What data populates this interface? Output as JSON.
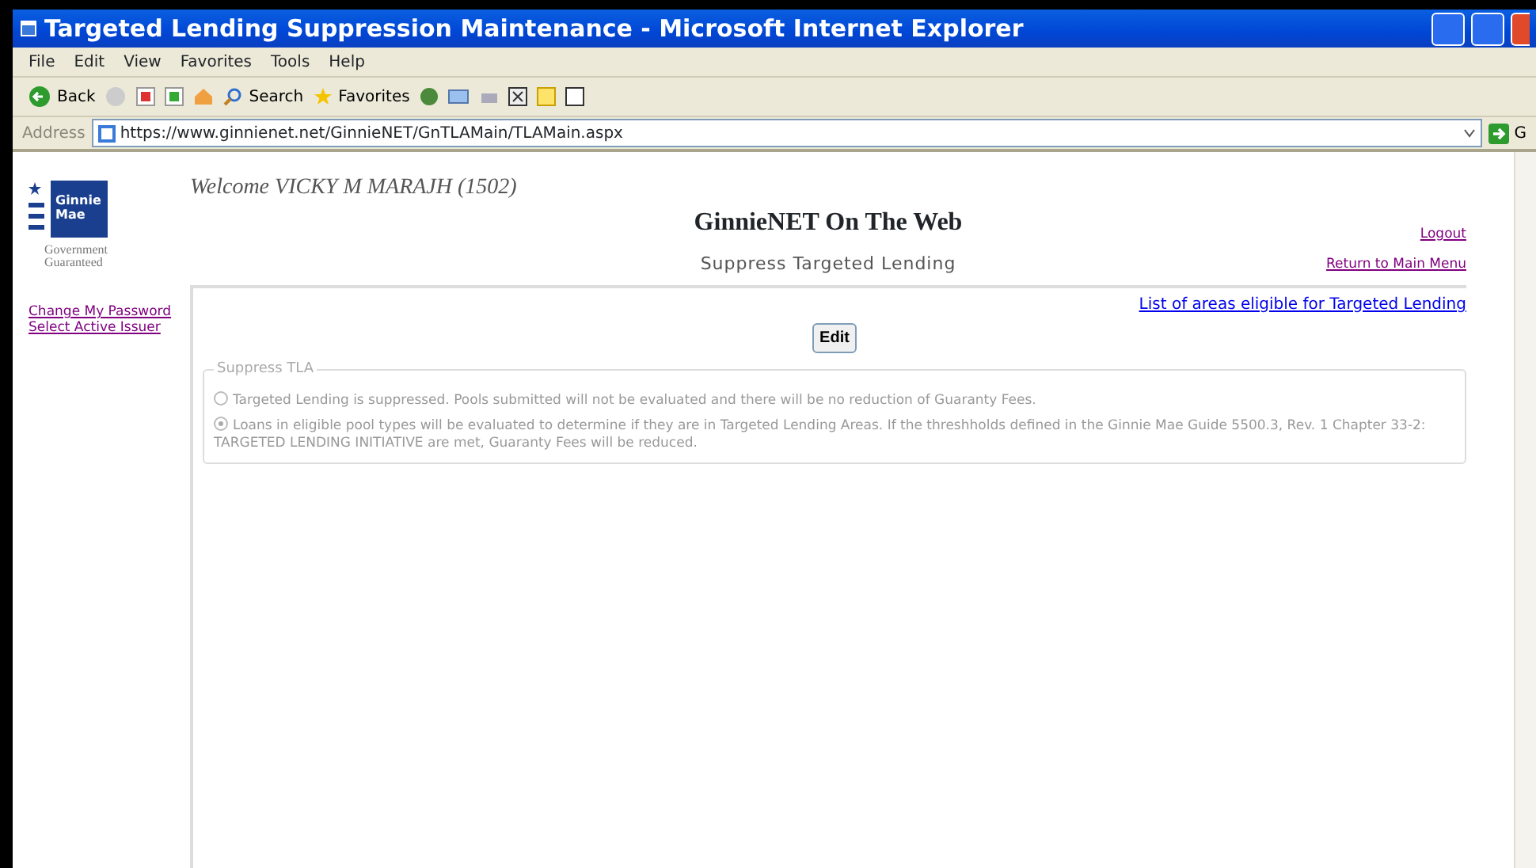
{
  "window": {
    "title": "Targeted Lending Suppression Maintenance - Microsoft Internet Explorer"
  },
  "menu": [
    "File",
    "Edit",
    "View",
    "Favorites",
    "Tools",
    "Help"
  ],
  "toolbar": {
    "back": "Back",
    "search": "Search",
    "favorites": "Favorites"
  },
  "address_bar": {
    "label": "Address",
    "url": "https://www.ginnienet.net/GinnieNET/GnTLAMain/TLAMain.aspx",
    "go": "G"
  },
  "logo": {
    "name_line_1": "Ginnie",
    "name_line_2": "Mae",
    "tagline_1": "Government",
    "tagline_2": "Guaranteed"
  },
  "sidebar": {
    "links": [
      "Change My Password",
      "Select Active Issuer"
    ]
  },
  "welcome": "Welcome VICKY M MARAJH (1502)",
  "site_title": "GinnieNET On The Web",
  "page_title": "Suppress Targeted Lending",
  "header_links": [
    "Logout",
    "Return to Main Menu"
  ],
  "eligible_link": "List of areas eligible for Targeted Lending",
  "edit_button": "Edit",
  "suppress_tla": {
    "legend": "Suppress TLA",
    "options": [
      {
        "label": "Targeted Lending is suppressed. Pools submitted will not be evaluated and there will be no reduction of Guaranty Fees.",
        "selected": false,
        "disabled": true
      },
      {
        "label": "Loans in eligible pool types will be evaluated to determine if they are in Targeted Lending Areas. If the threshholds defined in the Ginnie Mae Guide 5500.3, Rev. 1 Chapter 33-2: TARGETED LENDING INITIATIVE are met, Guaranty Fees will be reduced.",
        "selected": true,
        "disabled": true
      }
    ]
  }
}
